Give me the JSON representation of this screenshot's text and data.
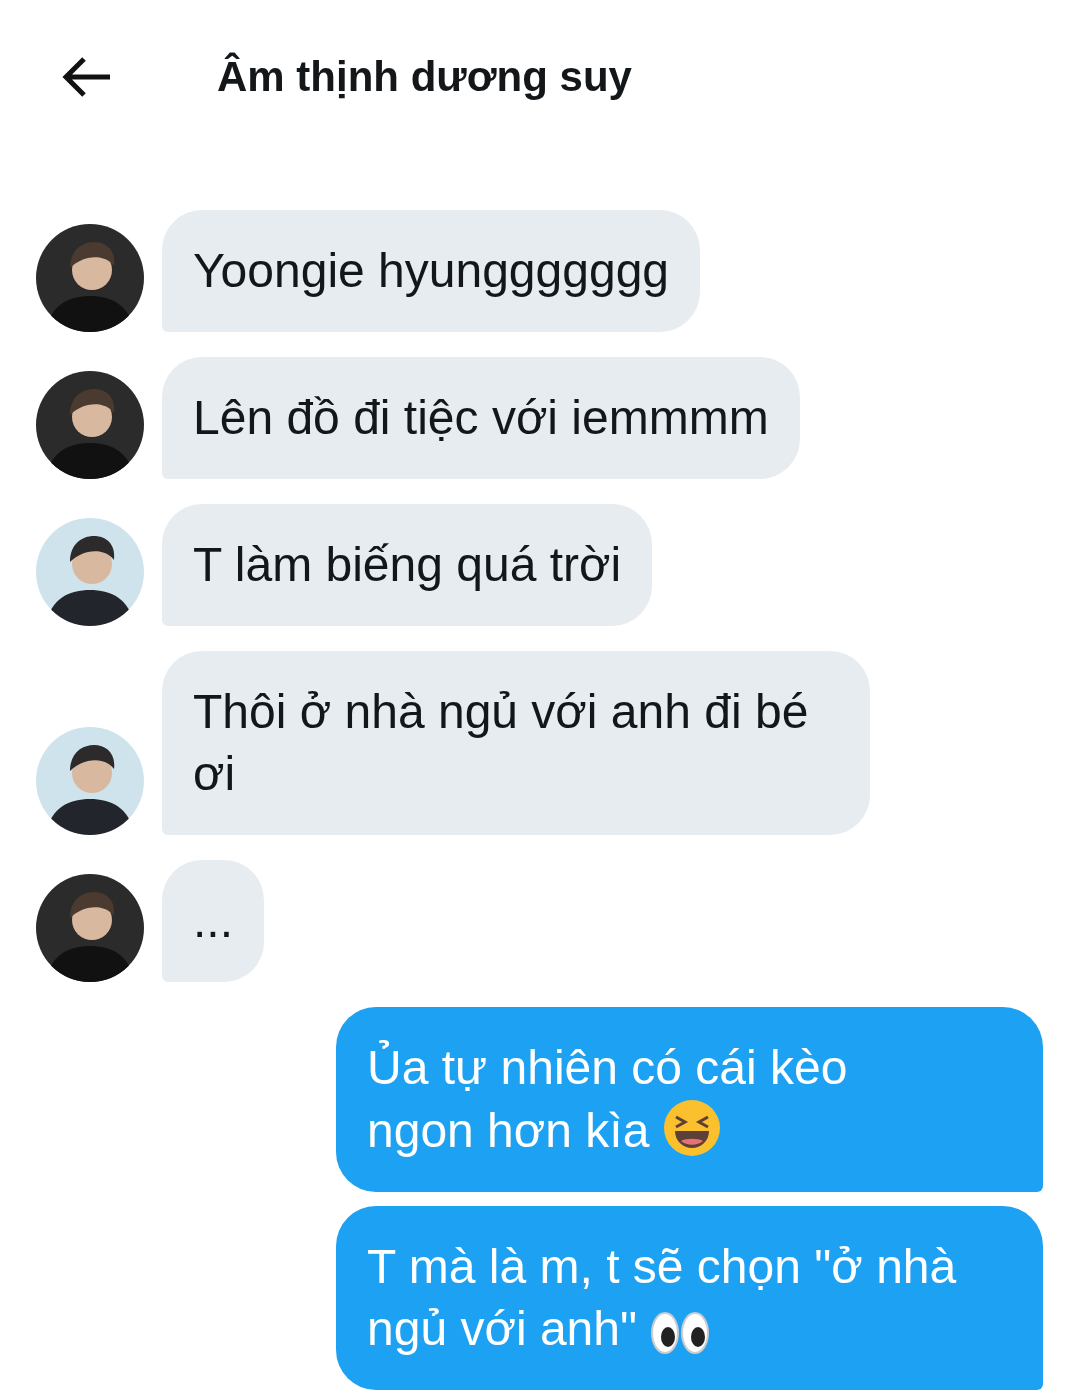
{
  "header": {
    "title": "Âm thịnh dương suy"
  },
  "messages": [
    {
      "kind": "incoming",
      "avatar": {
        "kind": "dark"
      },
      "text": "Yoongie hyunggggggg"
    },
    {
      "kind": "incoming",
      "avatar": {
        "kind": "dark"
      },
      "text": "Lên đồ đi tiệc với iemmmm"
    },
    {
      "kind": "incoming",
      "avatar": {
        "kind": "light"
      },
      "text": "T làm biếng quá trời"
    },
    {
      "kind": "incoming",
      "avatar": {
        "kind": "light"
      },
      "text": "Thôi ở nhà ngủ với anh đi bé ơi"
    },
    {
      "kind": "incoming",
      "avatar": {
        "kind": "dark"
      },
      "text": "..."
    },
    {
      "kind": "outgoing",
      "text": "Ủa tự nhiên có cái kèo ngon hơn kìa",
      "emoji": {
        "kind": "laugh"
      }
    },
    {
      "kind": "outgoing",
      "text": "T mà là m, t sẽ chọn \"ở nhà ngủ với anh\"",
      "emoji": {
        "kind": "eyes"
      }
    }
  ]
}
